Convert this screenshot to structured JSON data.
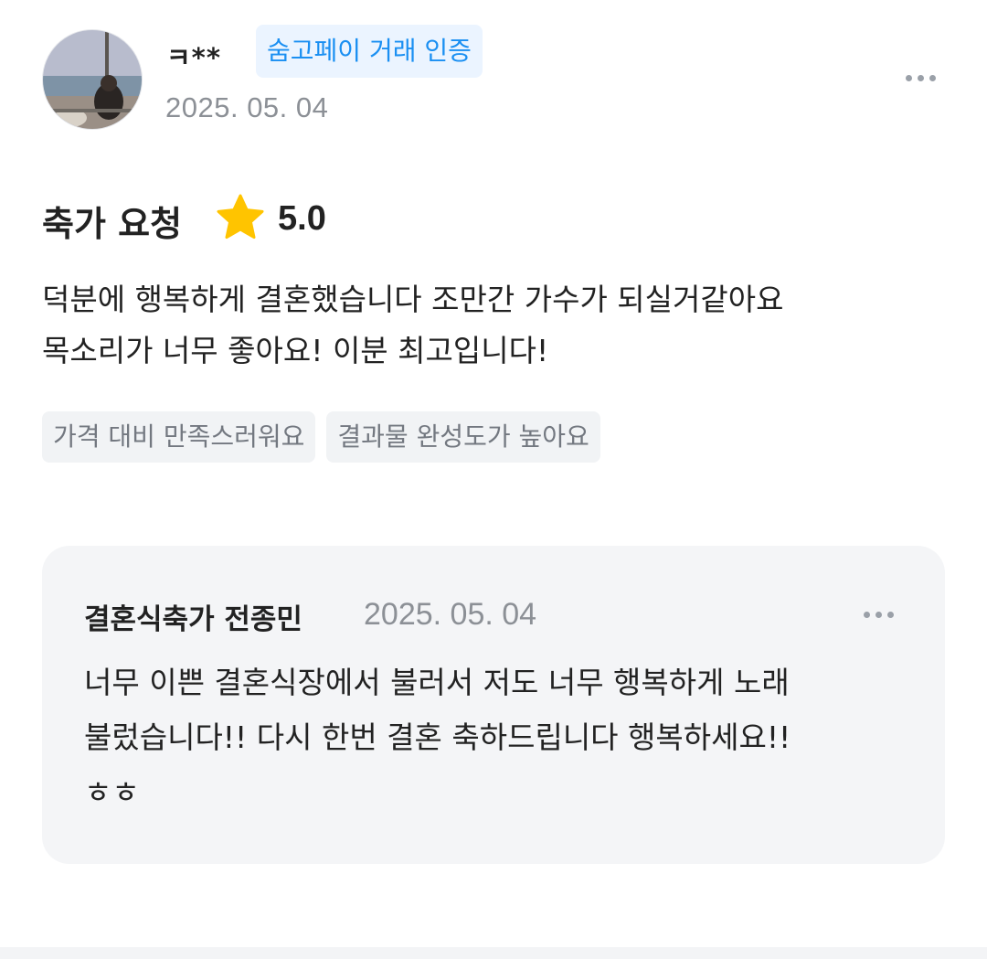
{
  "review": {
    "author_name": "ㅋ**",
    "verify_badge": "숨고페이 거래 인증",
    "date": "2025. 05. 04",
    "service_title": "축가 요청",
    "rating": "5.0",
    "star_color": "#ffc400",
    "body_lines": [
      "덕분에 행복하게 결혼했습니다 조만간 가수가 되실거같아요",
      "목소리가 너무 좋아요! 이분 최고입니다!"
    ],
    "tags": [
      "가격 대비 만족스러워요",
      "결과물 완성도가 높아요"
    ],
    "more_icon": "more-horizontal-icon"
  },
  "reply": {
    "author_name": "결혼식축가 전종민",
    "date": "2025. 05. 04",
    "body_lines": [
      "너무 이쁜 결혼식장에서 불러서 저도 너무 행복하게 노래",
      "불렀습니다!! 다시 한번 결혼 축하드립니다 행복하세요!!",
      "ㅎㅎ"
    ],
    "more_icon": "more-horizontal-icon"
  },
  "colors": {
    "badge_text": "#1a8ff2",
    "badge_bg": "#ebf4ff",
    "muted_text": "#8c9096",
    "reply_bg": "#f4f5f7",
    "tag_bg": "#f1f3f5"
  }
}
